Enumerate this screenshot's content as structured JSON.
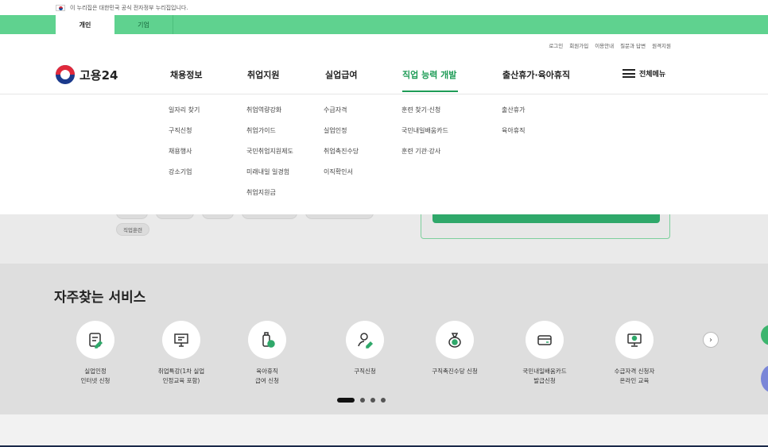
{
  "gov_banner": {
    "text": "이 누리집은 대한민국 공식 전자정부 누리집입니다."
  },
  "audience_tabs": [
    {
      "label": "개인"
    },
    {
      "label": "기업"
    }
  ],
  "util_links": [
    "로그인",
    "회원가입",
    "이용안내",
    "질문과 답변",
    "원격지원"
  ],
  "logo": {
    "text": "고용24"
  },
  "gnb": [
    {
      "label": "채용정보"
    },
    {
      "label": "취업지원"
    },
    {
      "label": "실업급여"
    },
    {
      "label": "직업 능력 개발"
    },
    {
      "label": "출산휴가·육아휴직"
    }
  ],
  "all_menu_label": "전체메뉴",
  "mega_menu": [
    [
      "일자리 찾기",
      "구직신청",
      "채용행사",
      "강소기업"
    ],
    [
      "취업역량강화",
      "취업가이드",
      "국민취업지원제도",
      "미래내일 일경험",
      "취업지원금"
    ],
    [
      "수급자격",
      "실업인정",
      "취업촉진수당",
      "이직확인서"
    ],
    [
      "훈련 찾기·신청",
      "국민내일배움카드",
      "훈련 기관·강사"
    ],
    [
      "출산휴가",
      "육아휴직"
    ]
  ],
  "keyword_chip": "직업훈련",
  "services": {
    "title": "자주찾는 서비스",
    "items": [
      {
        "label": "실업인정\n인터넷 신청",
        "icon": "document-pencil-icon"
      },
      {
        "label": "취업특강(1차 실업\n인정교육 포함)",
        "icon": "presentation-board-icon"
      },
      {
        "label": "육아휴직\n급여 신청",
        "icon": "baby-bottle-icon"
      },
      {
        "label": "구직신청",
        "icon": "person-pencil-icon"
      },
      {
        "label": "구직촉진수당 신청",
        "icon": "money-bag-icon"
      },
      {
        "label": "국민내일배움카드\n발급신청",
        "icon": "card-icon"
      },
      {
        "label": "수급자격 신청자\n온라인 교육",
        "icon": "monitor-play-icon"
      }
    ]
  },
  "colors": {
    "brand_green": "#1f9c57",
    "tab_bar": "#5fd28f"
  }
}
